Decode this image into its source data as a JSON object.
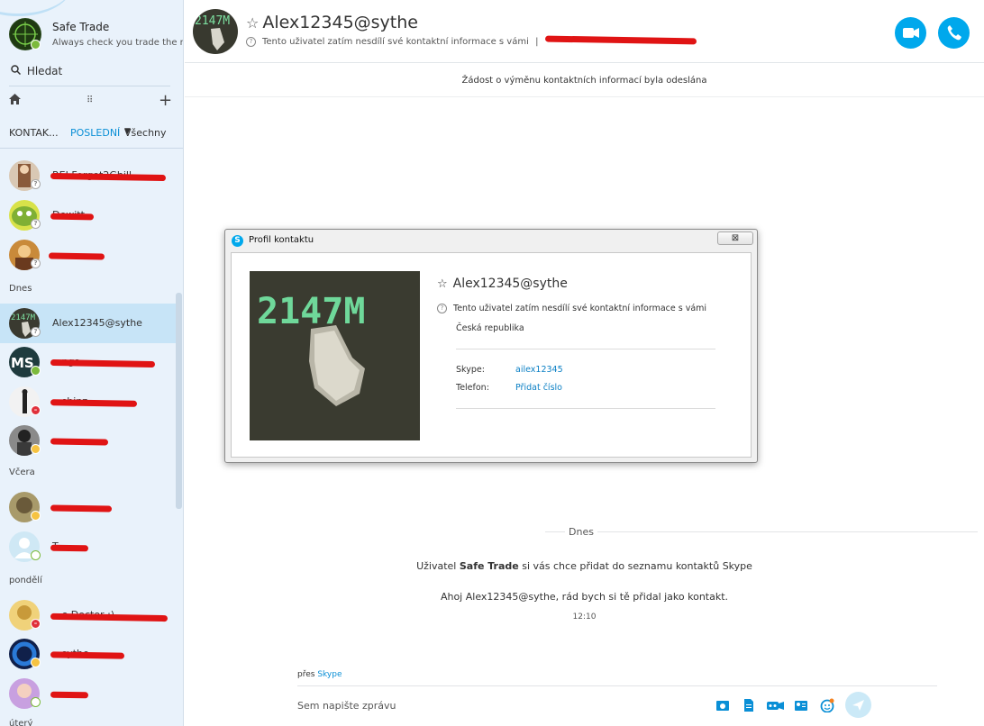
{
  "profile": {
    "name": "Safe Trade",
    "mood": "Always check you trade the r..."
  },
  "sidebar": {
    "search_label": "Hledat",
    "tabs": {
      "contacts": "KONTAK...",
      "recent": "POSLEDNÍ",
      "all": "Všechny"
    },
    "sections": {
      "today": "Dnes",
      "yesterday": "Včera",
      "monday": "pondělí",
      "partial": "úterý"
    },
    "contacts": [
      {
        "name": "REI Forgot2Ghill",
        "status": "unknown",
        "redacted": true
      },
      {
        "name": "Dewitt",
        "status": "unknown",
        "redacted": true
      },
      {
        "name": "",
        "status": "unknown",
        "redacted": true
      },
      {
        "name": "Alex12345@sythe",
        "status": "unknown",
        "redacted": false,
        "selected": true
      },
      {
        "name": "...ngs",
        "status": "online",
        "redacted": true
      },
      {
        "name": "...shinz",
        "status": "busy",
        "redacted": true
      },
      {
        "name": "...",
        "status": "away",
        "redacted": true
      },
      {
        "name": "...",
        "status": "away",
        "redacted": true
      },
      {
        "name": "T...",
        "status": "offline",
        "redacted": true
      },
      {
        "name": "...e Doctor :)",
        "status": "busy",
        "redacted": true
      },
      {
        "name": "...sythe",
        "status": "away",
        "redacted": true
      },
      {
        "name": "...",
        "status": "offline",
        "redacted": true
      }
    ]
  },
  "conversation": {
    "title": "Alex12345@sythe",
    "subtitle": "Tento uživatel zatím nesdílí své kontaktní informace s vámi",
    "subtitle_separator": "|",
    "contact_request_notice": "Žádost o výměnu kontaktních informací byla odeslána",
    "date_separator": "Dnes",
    "system_message": {
      "prefix": "Uživatel",
      "user": "Safe Trade",
      "suffix": "si vás chce přidat do seznamu kontaktů Skype"
    },
    "message": "Ahoj Alex12345@sythe, rád bych si tě přidal jako kontakt.",
    "time": "12:10"
  },
  "composer": {
    "via_label": "přes",
    "via_link": "Skype",
    "placeholder": "Sem napište zprávu"
  },
  "dialog": {
    "window_title": "Profil kontaktu",
    "close_label": "⊠",
    "name": "Alex12345@sythe",
    "notice": "Tento uživatel zatím nesdílí své kontaktní informace s vámi",
    "country": "Česká republika",
    "fields": [
      {
        "label": "Skype:",
        "value": "ailex12345"
      },
      {
        "label": "Telefon:",
        "value": "Přidat číslo"
      }
    ],
    "photo_text": "2147M"
  },
  "colors": {
    "accent": "#00a8ec",
    "sidebar_bg": "#e9f2fb",
    "selected_row": "#c7e4f7",
    "link": "#0a8fd6",
    "redaction": "#e01414"
  }
}
